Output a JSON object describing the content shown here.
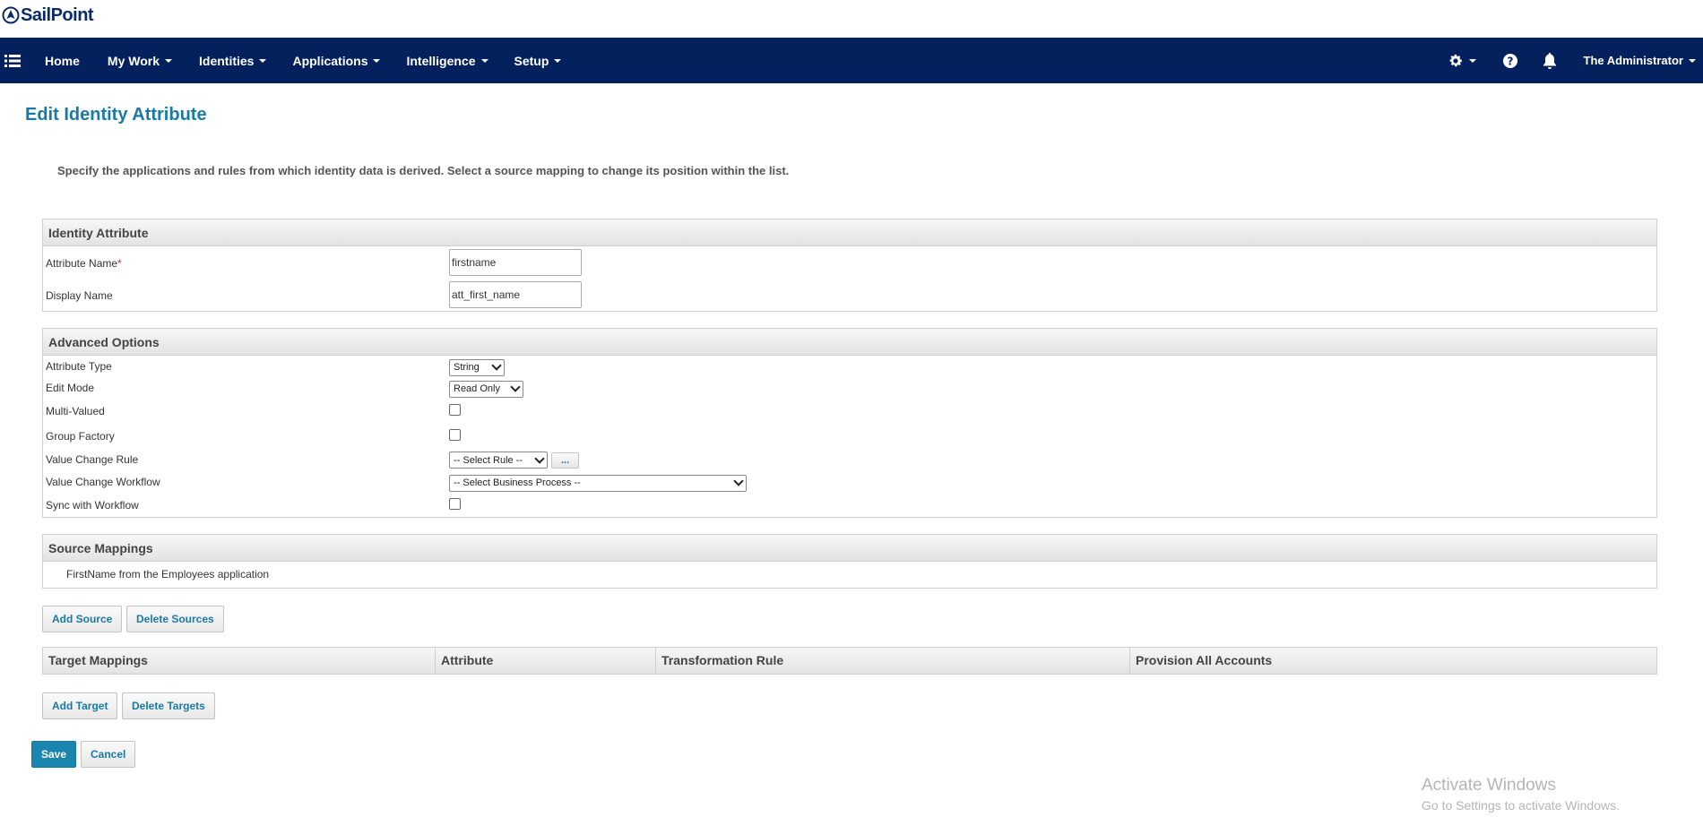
{
  "brand": {
    "logo_text": "SailPoint"
  },
  "nav": {
    "items": [
      {
        "label": "Home",
        "dropdown": false
      },
      {
        "label": "My Work",
        "dropdown": true
      },
      {
        "label": "Identities",
        "dropdown": true
      },
      {
        "label": "Applications",
        "dropdown": true
      },
      {
        "label": "Intelligence",
        "dropdown": true
      },
      {
        "label": "Setup",
        "dropdown": true
      }
    ],
    "user_label": "The Administrator",
    "icons": [
      "menu-icon",
      "gear-icon",
      "help-icon",
      "bell-icon"
    ]
  },
  "page": {
    "title": "Edit Identity Attribute",
    "instructions": "Specify the applications and rules from which identity data is derived. Select a source mapping to change its position within the list."
  },
  "identity_attribute": {
    "header": "Identity Attribute",
    "attribute_name_label": "Attribute Name",
    "required_marker": "*",
    "attribute_name_value": "firstname",
    "display_name_label": "Display Name",
    "display_name_value": "att_first_name"
  },
  "advanced": {
    "header": "Advanced Options",
    "attribute_type_label": "Attribute Type",
    "attribute_type_value": "String",
    "edit_mode_label": "Edit Mode",
    "edit_mode_value": "Read Only",
    "multi_valued_label": "Multi-Valued",
    "multi_valued_checked": false,
    "group_factory_label": "Group Factory",
    "group_factory_checked": false,
    "value_change_rule_label": "Value Change Rule",
    "value_change_rule_value": "-- Select Rule --",
    "rule_button_label": "...",
    "value_change_workflow_label": "Value Change Workflow",
    "value_change_workflow_value": "-- Select Business Process --",
    "sync_workflow_label": "Sync with Workflow",
    "sync_workflow_checked": false
  },
  "source_mappings": {
    "header": "Source Mappings",
    "items": [
      "FirstName from the Employees application"
    ],
    "add_label": "Add Source",
    "delete_label": "Delete Sources"
  },
  "target_mappings": {
    "columns": [
      "Target Mappings",
      "Attribute",
      "Transformation Rule",
      "Provision All Accounts"
    ],
    "add_label": "Add Target",
    "delete_label": "Delete Targets"
  },
  "actions": {
    "save_label": "Save",
    "cancel_label": "Cancel"
  },
  "watermark": {
    "line1": "Activate Windows",
    "line2": "Go to Settings to activate Windows."
  },
  "colors": {
    "nav_bg": "#04215e",
    "title": "#1a7aa6",
    "primary_button": "#1a86b0"
  }
}
